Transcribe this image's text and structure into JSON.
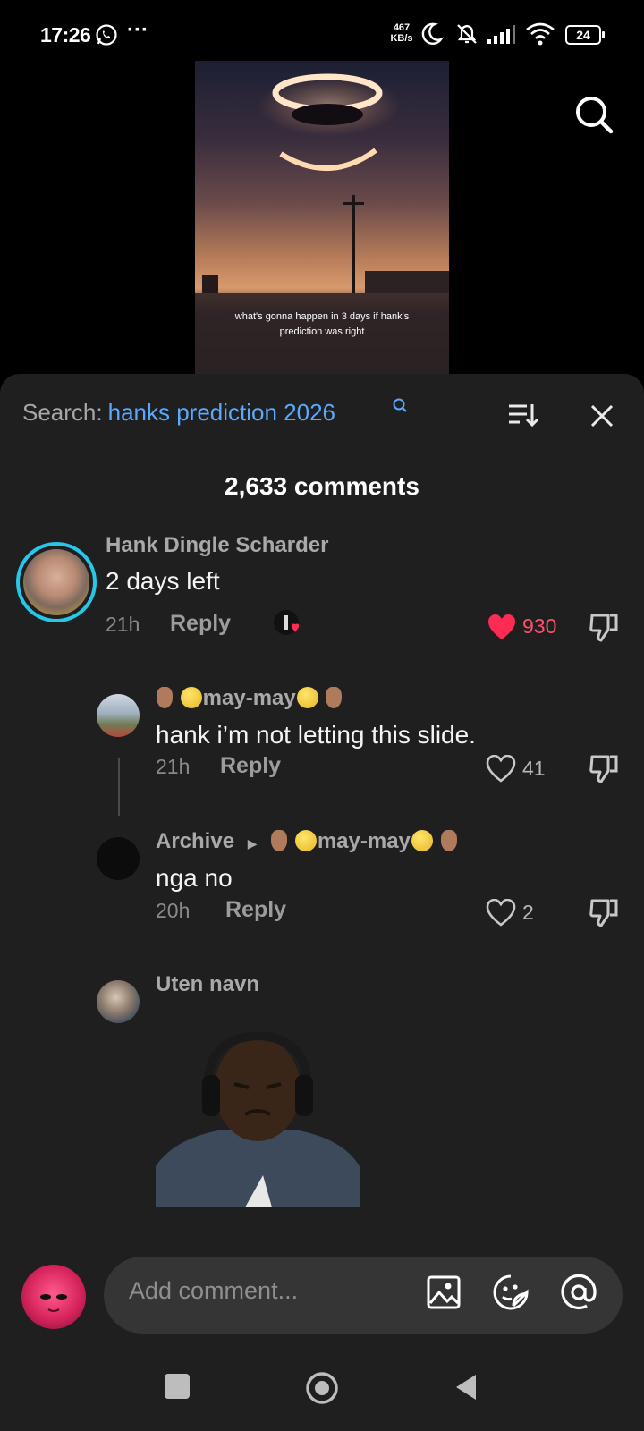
{
  "status_bar": {
    "time": "17:26",
    "network_speed_value": "467",
    "network_speed_unit": "KB/s",
    "battery": "24"
  },
  "video": {
    "caption": "what's gonna happen in 3 days if hank's prediction was right"
  },
  "comments_sheet": {
    "search_label": "Search:",
    "search_query": "hanks prediction 2026",
    "count_label": "2,633 comments",
    "comments": [
      {
        "username": "Hank Dingle Scharder",
        "text": "2 days left",
        "time": "21h",
        "reply_label": "Reply",
        "likes": "930",
        "liked": true
      },
      {
        "username": "may-may",
        "text": "hank i’m not letting this slide.",
        "time": "21h",
        "reply_label": "Reply",
        "likes": "41",
        "liked": false
      },
      {
        "username": "Archive",
        "reply_to": "may-may",
        "text": "nga no",
        "time": "20h",
        "reply_label": "Reply",
        "likes": "2",
        "liked": false
      },
      {
        "username": "Uten navn",
        "text": "",
        "sticker": "man-wearing-headphones-sticker"
      }
    ]
  },
  "input_bar": {
    "placeholder": "Add comment..."
  },
  "colors": {
    "accent_blue": "#5aa9ff",
    "like_red": "#fe2c55",
    "sheet_bg": "#1f1f1f"
  },
  "icons": [
    "whatsapp-icon",
    "search-icon",
    "sort-icon",
    "close-icon",
    "heart-icon",
    "dislike-icon",
    "image-icon",
    "sticker-icon",
    "mention-icon"
  ]
}
